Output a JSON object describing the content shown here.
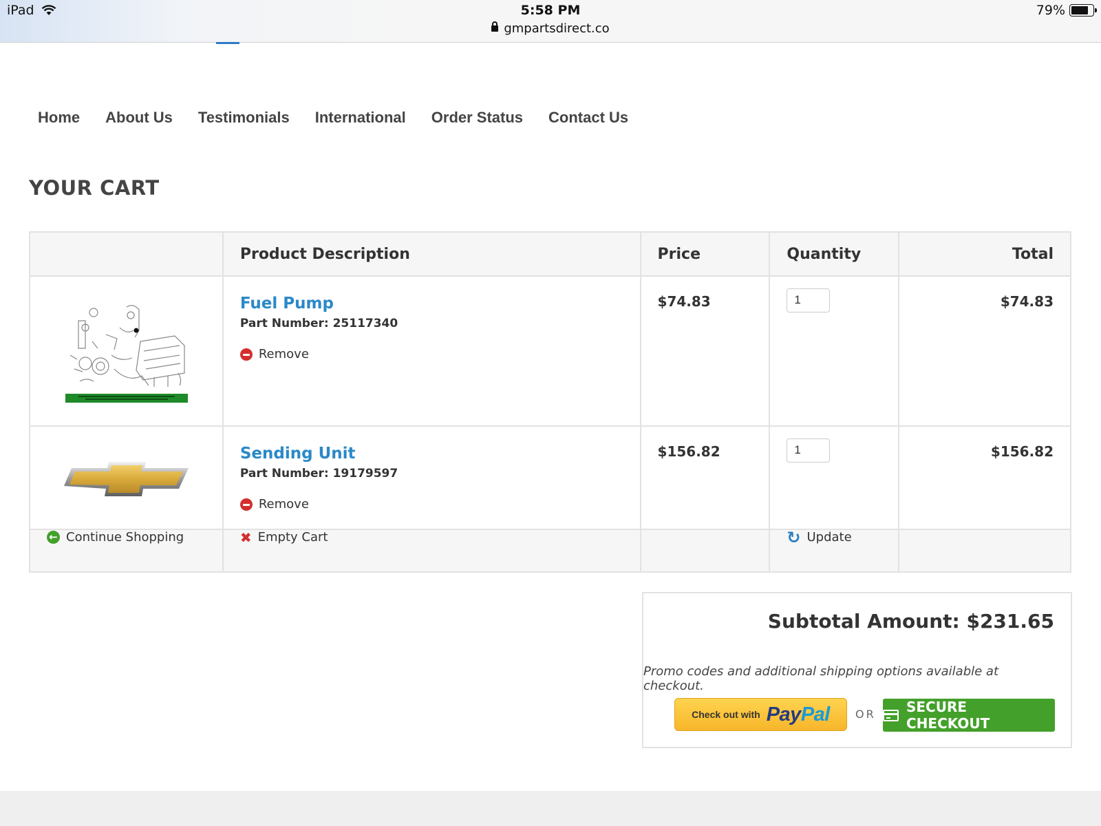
{
  "status_bar": {
    "device": "iPad",
    "time": "5:58 PM",
    "url": "gmpartsdirect.co",
    "battery": "79%",
    "battery_level": 0.79
  },
  "nav": [
    "Home",
    "About Us",
    "Testimonials",
    "International",
    "Order Status",
    "Contact Us"
  ],
  "page_title": "YOUR CART",
  "table": {
    "headers": {
      "description": "Product Description",
      "price": "Price",
      "quantity": "Quantity",
      "total": "Total"
    },
    "items": [
      {
        "name": "Fuel Pump",
        "part_number": "Part Number: 25117340",
        "remove_label": "Remove",
        "price": "$74.83",
        "quantity": "1",
        "total": "$74.83",
        "image": "fuel-pump-diagram"
      },
      {
        "name": "Sending Unit",
        "part_number": "Part Number: 19179597",
        "remove_label": "Remove",
        "price": "$156.82",
        "quantity": "1",
        "total": "$156.82",
        "image": "chevrolet-bowtie-logo"
      }
    ],
    "actions": {
      "continue_shopping": "Continue Shopping",
      "empty_cart": "Empty Cart",
      "update": "Update"
    }
  },
  "summary": {
    "subtotal": "Subtotal Amount: $231.65",
    "promo_note": "Promo codes and additional shipping options available at checkout.",
    "paypal_prefix": "Check out with",
    "paypal_pay": "Pay",
    "paypal_pal": "Pal",
    "or": "OR",
    "secure_checkout": "SECURE CHECKOUT"
  },
  "colors": {
    "link_blue": "#2a89c8",
    "checkout_green": "#43a02a",
    "remove_red": "#d32f2f",
    "paypal_yellow": "#ffc439"
  }
}
